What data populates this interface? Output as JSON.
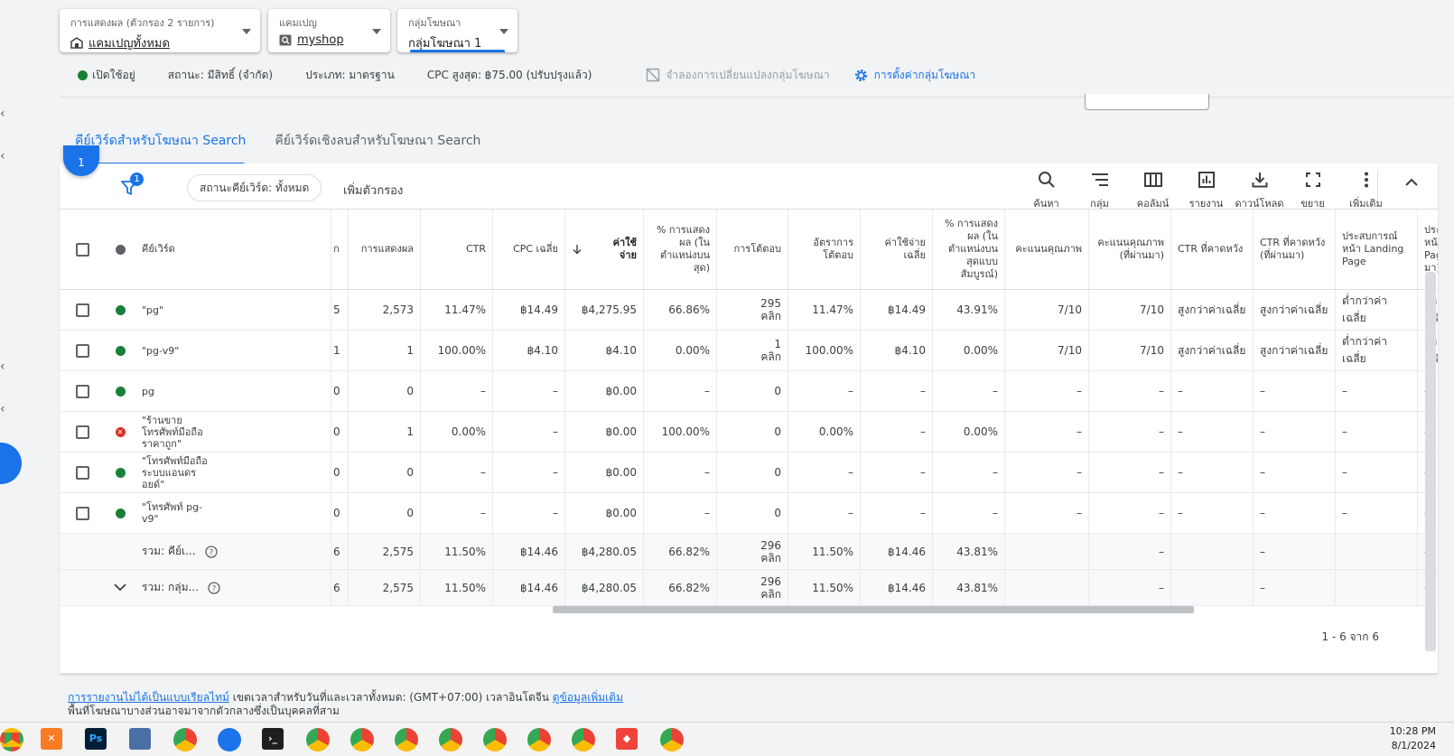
{
  "selectors": [
    {
      "label": "การแสดงผล (ตัวกรอง 2 รายการ)",
      "value": "แคมเปญทั้งหมด",
      "icon": "store-icon"
    },
    {
      "label": "แคมเปญ",
      "value": "myshop",
      "icon": "search-campaign-icon"
    },
    {
      "label": "กลุ่มโฆษณา",
      "value": "กลุ่มโฆษณา 1"
    }
  ],
  "status_bar": {
    "enabled": "เปิดใช้อยู่",
    "status": "สถานะ: มีสิทธิ์ (จำกัด)",
    "type": "ประเภท: มาตรฐาน",
    "max_cpc": "CPC สูงสุด: ฿75.00 (ปรับปรุงแล้ว)",
    "simulate": "จำลองการเปลี่ยนแปลงกลุ่มโฆษณา",
    "settings": "การตั้งค่ากลุ่มโฆษณา"
  },
  "tabs": [
    {
      "label": "คีย์เวิร์ดสำหรับโฆษณา Search",
      "active": true
    },
    {
      "label": "คีย์เวิร์ดเชิงลบสำหรับโฆษณา Search",
      "active": false
    }
  ],
  "toolbar": {
    "filter_count": "1",
    "chip": "สถานะคีย์เวิร์ด: ทั้งหมด",
    "add_filter": "เพิ่มตัวกรอง",
    "tools": [
      {
        "label": "ค้นหา",
        "icon": "search-icon"
      },
      {
        "label": "กลุ่ม",
        "icon": "segment-icon"
      },
      {
        "label": "คอลัมน์",
        "icon": "columns-icon"
      },
      {
        "label": "รายงาน",
        "icon": "report-icon"
      },
      {
        "label": "ดาวน์โหลด",
        "icon": "download-icon"
      },
      {
        "label": "ขยาย",
        "icon": "expand-icon"
      },
      {
        "label": "เพิ่มเติม",
        "icon": "more-icon"
      }
    ]
  },
  "table": {
    "headers": {
      "keyword": "คีย์เวิร์ด",
      "clicks_partial": "ก",
      "impressions": "การแสดงผล",
      "ctr": "CTR",
      "avg_cpc": "CPC เฉลี่ย",
      "cost": "ค่าใช้จ่าย",
      "impr_top": "% การแสดงผล (ในตำแหน่งบนสุด)",
      "interactions": "การโต้ตอบ",
      "interaction_rate": "อัตราการโต้ตอบ",
      "avg_cost": "ค่าใช้จ่ายเฉลี่ย",
      "impr_abs_top": "% การแสดงผล (ในตำแหน่งบนสุดแบบสัมบูรณ์)",
      "quality_score": "คะแนนคุณภาพ",
      "quality_score_hist": "คะแนนคุณภาพ (ที่ผ่านมา)",
      "exp_ctr": "CTR ที่คาดหวัง",
      "exp_ctr_hist": "CTR ที่คาดหวัง (ที่ผ่านมา)",
      "lp_exp": "ประสบการณ์หน้า Landing Page",
      "lp_exp_hist": "ประสบการณ์หน้า Landing Page (ที่ผ่านมา)"
    },
    "rows": [
      {
        "status": "enabled",
        "keyword": "\"pg\"",
        "clicks": "5",
        "impressions": "2,573",
        "ctr": "11.47%",
        "avg_cpc": "฿14.49",
        "cost": "฿4,275.95",
        "impr_top": "66.86%",
        "interactions": "295\nคลิก",
        "interaction_rate": "11.47%",
        "avg_cost": "฿14.49",
        "impr_abs_top": "43.91%",
        "quality_score": "7/10",
        "quality_score_hist": "7/10",
        "exp_ctr": "สูงกว่าค่าเฉลี่ย",
        "exp_ctr_hist": "สูงกว่าค่าเฉลี่ย",
        "lp_exp": "ต่ำกว่าค่าเฉลี่ย",
        "lp_exp_hist": "ต่ำกว่าค่าเฉลี่ย"
      },
      {
        "status": "enabled",
        "keyword": "\"pg-v9\"",
        "clicks": "1",
        "impressions": "1",
        "ctr": "100.00%",
        "avg_cpc": "฿4.10",
        "cost": "฿4.10",
        "impr_top": "0.00%",
        "interactions": "1\nคลิก",
        "interaction_rate": "100.00%",
        "avg_cost": "฿4.10",
        "impr_abs_top": "0.00%",
        "quality_score": "7/10",
        "quality_score_hist": "7/10",
        "exp_ctr": "สูงกว่าค่าเฉลี่ย",
        "exp_ctr_hist": "สูงกว่าค่าเฉลี่ย",
        "lp_exp": "ต่ำกว่าค่าเฉลี่ย",
        "lp_exp_hist": "ต่ำกว่าค่าเฉลี่ย"
      },
      {
        "status": "enabled",
        "keyword": "pg",
        "clicks": "0",
        "impressions": "0",
        "ctr": "–",
        "avg_cpc": "–",
        "cost": "฿0.00",
        "impr_top": "–",
        "interactions": "0",
        "interaction_rate": "–",
        "avg_cost": "–",
        "impr_abs_top": "–",
        "quality_score": "–",
        "quality_score_hist": "–",
        "exp_ctr": "–",
        "exp_ctr_hist": "–",
        "lp_exp": "–",
        "lp_exp_hist": "–"
      },
      {
        "status": "removed",
        "keyword": "\"ร้านขาย\nโทรศัพท์มือถือ\nราคาถูก\"",
        "clicks": "0",
        "impressions": "1",
        "ctr": "0.00%",
        "avg_cpc": "–",
        "cost": "฿0.00",
        "impr_top": "100.00%",
        "interactions": "0",
        "interaction_rate": "0.00%",
        "avg_cost": "–",
        "impr_abs_top": "0.00%",
        "quality_score": "–",
        "quality_score_hist": "–",
        "exp_ctr": "–",
        "exp_ctr_hist": "–",
        "lp_exp": "–",
        "lp_exp_hist": "–"
      },
      {
        "status": "enabled",
        "keyword": "\"โทรศัพท์มือถือ\nระบบแอนดร\nอยด์\"",
        "clicks": "0",
        "impressions": "0",
        "ctr": "–",
        "avg_cpc": "–",
        "cost": "฿0.00",
        "impr_top": "–",
        "interactions": "0",
        "interaction_rate": "–",
        "avg_cost": "–",
        "impr_abs_top": "–",
        "quality_score": "–",
        "quality_score_hist": "–",
        "exp_ctr": "–",
        "exp_ctr_hist": "–",
        "lp_exp": "–",
        "lp_exp_hist": "–"
      },
      {
        "status": "enabled",
        "keyword": "\"โทรศัพท์ pg-\nv9\"",
        "clicks": "0",
        "impressions": "0",
        "ctr": "–",
        "avg_cpc": "–",
        "cost": "฿0.00",
        "impr_top": "–",
        "interactions": "0",
        "interaction_rate": "–",
        "avg_cost": "–",
        "impr_abs_top": "–",
        "quality_score": "–",
        "quality_score_hist": "–",
        "exp_ctr": "–",
        "exp_ctr_hist": "–",
        "lp_exp": "–",
        "lp_exp_hist": "–"
      }
    ],
    "totals": [
      {
        "label": "รวม: คีย์เ...",
        "clicks": "6",
        "impressions": "2,575",
        "ctr": "11.50%",
        "avg_cpc": "฿14.46",
        "cost": "฿4,280.05",
        "impr_top": "66.82%",
        "interactions": "296\nคลิก",
        "interaction_rate": "11.50%",
        "avg_cost": "฿14.46",
        "impr_abs_top": "43.81%",
        "quality_score_hist": "–",
        "exp_ctr_hist": "–",
        "lp_exp_hist": "–"
      },
      {
        "label": "รวม: กลุ่ม...",
        "clicks": "6",
        "impressions": "2,575",
        "ctr": "11.50%",
        "avg_cpc": "฿14.46",
        "cost": "฿4,280.05",
        "impr_top": "66.82%",
        "interactions": "296\nคลิก",
        "interaction_rate": "11.50%",
        "avg_cost": "฿14.46",
        "impr_abs_top": "43.81%",
        "quality_score_hist": "–",
        "exp_ctr_hist": "–",
        "lp_exp_hist": "–"
      }
    ],
    "pagination": "1 - 6 จาก 6"
  },
  "footer": {
    "link1": "การรายงานไม่ได้เป็นแบบเรียลไทม์",
    "text1": " เขตเวลาสำหรับวันที่และเวลาทั้งหมด: (GMT+07:00) เวลาอินโดจีน ",
    "link2": "ดูข้อมูลเพิ่มเติม",
    "text2": "พื้นที่โฆษณาบางส่วนอาจมาจากตัวกลางซึ่งเป็นบุคคลที่สาม"
  },
  "taskbar": {
    "time": "10:28 PM",
    "date": "8/1/2024",
    "apps": [
      "chrome-icon",
      "xampp-icon",
      "photoshop-icon",
      "app-icon",
      "chrome-icon",
      "app-icon",
      "terminal-icon",
      "chrome-icon",
      "chrome-icon",
      "chrome-icon",
      "chrome-icon",
      "chrome-icon",
      "chrome-icon",
      "chrome-icon",
      "anydesk-icon",
      "chrome-icon"
    ]
  },
  "colors": {
    "accent": "#1a73e8",
    "enabled": "#188038",
    "removed": "#d93025"
  }
}
